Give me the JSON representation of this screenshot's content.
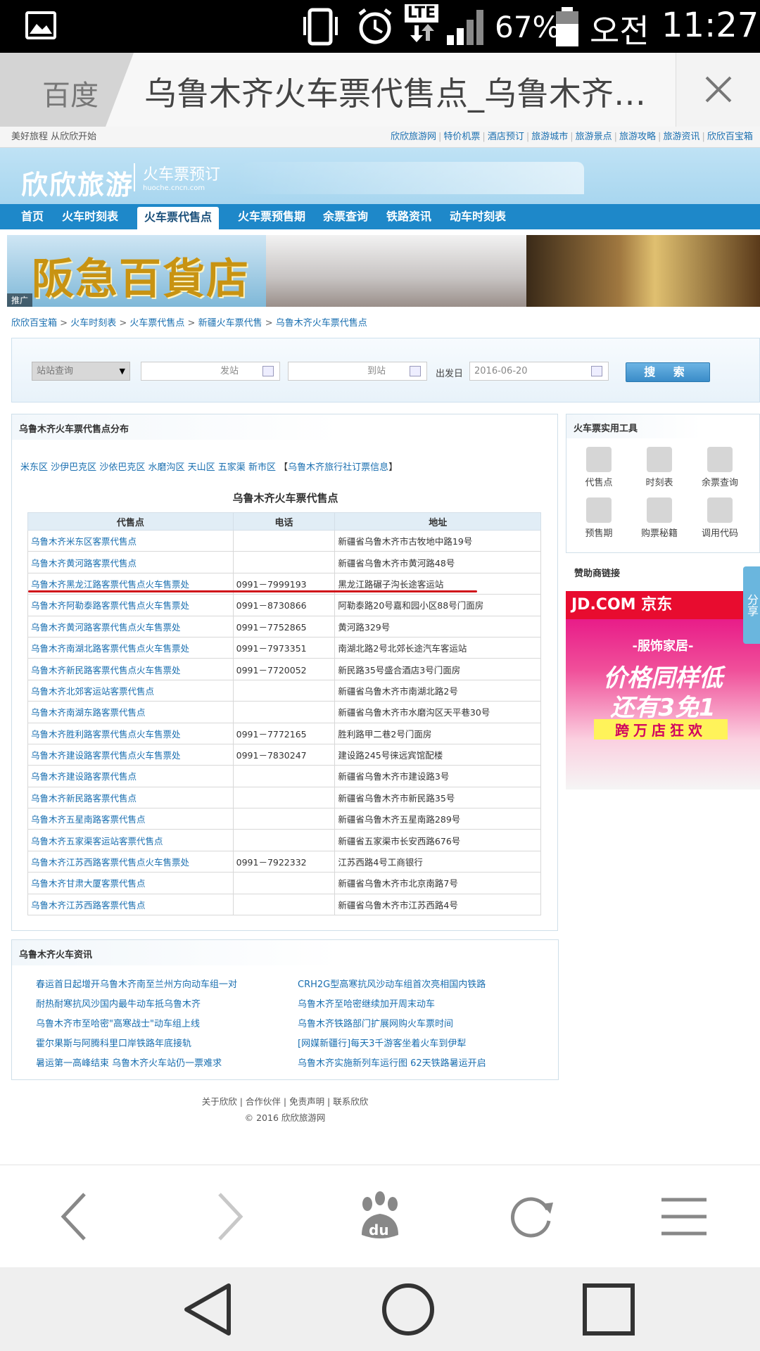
{
  "status_bar": {
    "battery": "67%",
    "ampm": "오전",
    "time": "11:27",
    "network": "LTE"
  },
  "browser": {
    "prev_tab_title": "百度",
    "current_tab_title": "乌鲁木齐火车票代售点_乌鲁木齐火..."
  },
  "site": {
    "slogan": "美好旅程 从欣欣开始",
    "top_links": [
      "欣欣旅游网",
      "特价机票",
      "酒店预订",
      "旅游城市",
      "旅游景点",
      "旅游攻略",
      "旅游资讯",
      "欣欣百宝箱"
    ],
    "logo": "欣欣旅游",
    "logo_sub": "火车票预订",
    "logo_url": "huoche.cncn.com",
    "nav": [
      "首页",
      "火车时刻表",
      "火车票代售点",
      "火车票预售期",
      "余票查询",
      "铁路资讯",
      "动车时刻表"
    ],
    "ad_text": "阪急百貨店",
    "ad_tag": "推广"
  },
  "breadcrumb": [
    "欣欣百宝箱",
    "火车时刻表",
    "火车票代售点",
    "新疆火车票代售",
    "乌鲁木齐火车票代售点"
  ],
  "search": {
    "select_value": "站站查询",
    "from_placeholder": "发站",
    "to_placeholder": "到站",
    "date_label": "出发日",
    "date_value": "2016-06-20",
    "button": "搜 索"
  },
  "main": {
    "panel_title": "乌鲁木齐火车票代售点分布",
    "districts": [
      "米东区",
      "沙伊巴克区",
      "沙依巴克区",
      "水磨沟区",
      "天山区",
      "五家渠",
      "新市区"
    ],
    "district_extra": "乌鲁木齐旅行社订票信息",
    "table_title": "乌鲁木齐火车票代售点",
    "columns": [
      "代售点",
      "电话",
      "地址"
    ],
    "rows": [
      {
        "name": "乌鲁木齐米东区客票代售点",
        "phone": "",
        "address": "新疆省乌鲁木齐市古牧地中路19号"
      },
      {
        "name": "乌鲁木齐黄河路客票代售点",
        "phone": "",
        "address": "新疆省乌鲁木齐市黄河路48号"
      },
      {
        "name": "乌鲁木齐黑龙江路客票代售点火车售票处",
        "phone": "0991－7999193",
        "address": "黑龙江路碾子沟长途客运站"
      },
      {
        "name": "乌鲁木齐阿勒泰路客票代售点火车售票处",
        "phone": "0991－8730866",
        "address": "阿勒泰路20号嘉和园小区88号门面房"
      },
      {
        "name": "乌鲁木齐黄河路客票代售点火车售票处",
        "phone": "0991－7752865",
        "address": "黄河路329号"
      },
      {
        "name": "乌鲁木齐南湖北路客票代售点火车售票处",
        "phone": "0991－7973351",
        "address": "南湖北路2号北郊长途汽车客运站"
      },
      {
        "name": "乌鲁木齐新民路客票代售点火车售票处",
        "phone": "0991－7720052",
        "address": "新民路35号盛合酒店3号门面房"
      },
      {
        "name": "乌鲁木齐北郊客运站客票代售点",
        "phone": "",
        "address": "新疆省乌鲁木齐市南湖北路2号"
      },
      {
        "name": "乌鲁木齐南湖东路客票代售点",
        "phone": "",
        "address": "新疆省乌鲁木齐市水磨沟区天平巷30号"
      },
      {
        "name": "乌鲁木齐胜利路客票代售点火车售票处",
        "phone": "0991－7772165",
        "address": "胜利路甲二巷2号门面房"
      },
      {
        "name": "乌鲁木齐建设路客票代售点火车售票处",
        "phone": "0991－7830247",
        "address": "建设路245号徕远宾馆配楼"
      },
      {
        "name": "乌鲁木齐建设路客票代售点",
        "phone": "",
        "address": "新疆省乌鲁木齐市建设路3号"
      },
      {
        "name": "乌鲁木齐新民路客票代售点",
        "phone": "",
        "address": "新疆省乌鲁木齐市新民路35号"
      },
      {
        "name": "乌鲁木齐五星南路客票代售点",
        "phone": "",
        "address": "新疆省乌鲁木齐五星南路289号"
      },
      {
        "name": "乌鲁木齐五家渠客运站客票代售点",
        "phone": "",
        "address": "新疆省五家渠市长安西路676号"
      },
      {
        "name": "乌鲁木齐江苏西路客票代售点火车售票处",
        "phone": "0991－7922332",
        "address": "江苏西路4号工商银行"
      },
      {
        "name": "乌鲁木齐甘肃大厦客票代售点",
        "phone": "",
        "address": "新疆省乌鲁木齐市北京南路7号"
      },
      {
        "name": "乌鲁木齐江苏西路客票代售点",
        "phone": "",
        "address": "新疆省乌鲁木齐市江苏西路4号"
      }
    ]
  },
  "side": {
    "tools_title": "火车票实用工具",
    "tools": [
      "代售点",
      "时刻表",
      "余票查询",
      "预售期",
      "购票秘籍",
      "调用代码"
    ],
    "sponsor_title": "赞助商链接",
    "jd_head": "JD.COM 京东",
    "jd_line1": "-服饰家居-",
    "jd_line2": "价格同样低",
    "jd_line3": "还有3免1",
    "jd_line4": "跨万店狂欢",
    "share": "分享"
  },
  "news": {
    "title": "乌鲁木齐火车资讯",
    "left": [
      "春运首日起增开乌鲁木齐南至兰州方向动车组一对",
      "耐热耐寒抗风沙国内最牛动车抵乌鲁木齐",
      "乌鲁木齐市至哈密\"高寒战士\"动车组上线",
      "霍尔果斯与阿腾科里口岸铁路年底接轨",
      "暑运第一高峰结束 乌鲁木齐火车站仍一票难求"
    ],
    "right": [
      "CRH2G型高寒抗风沙动车组首次亮相国内铁路",
      "乌鲁木齐至哈密继续加开周末动车",
      "乌鲁木齐铁路部门扩展网购火车票时间",
      "[网媒新疆行]每天3千游客坐着火车到伊犁",
      "乌鲁木齐实施新列车运行图 62天铁路暑运开启"
    ]
  },
  "footer": {
    "links": "关于欣欣 | 合作伙伴 | 免责声明 | 联系欣欣",
    "copyright": "© 2016 欣欣旅游网"
  }
}
